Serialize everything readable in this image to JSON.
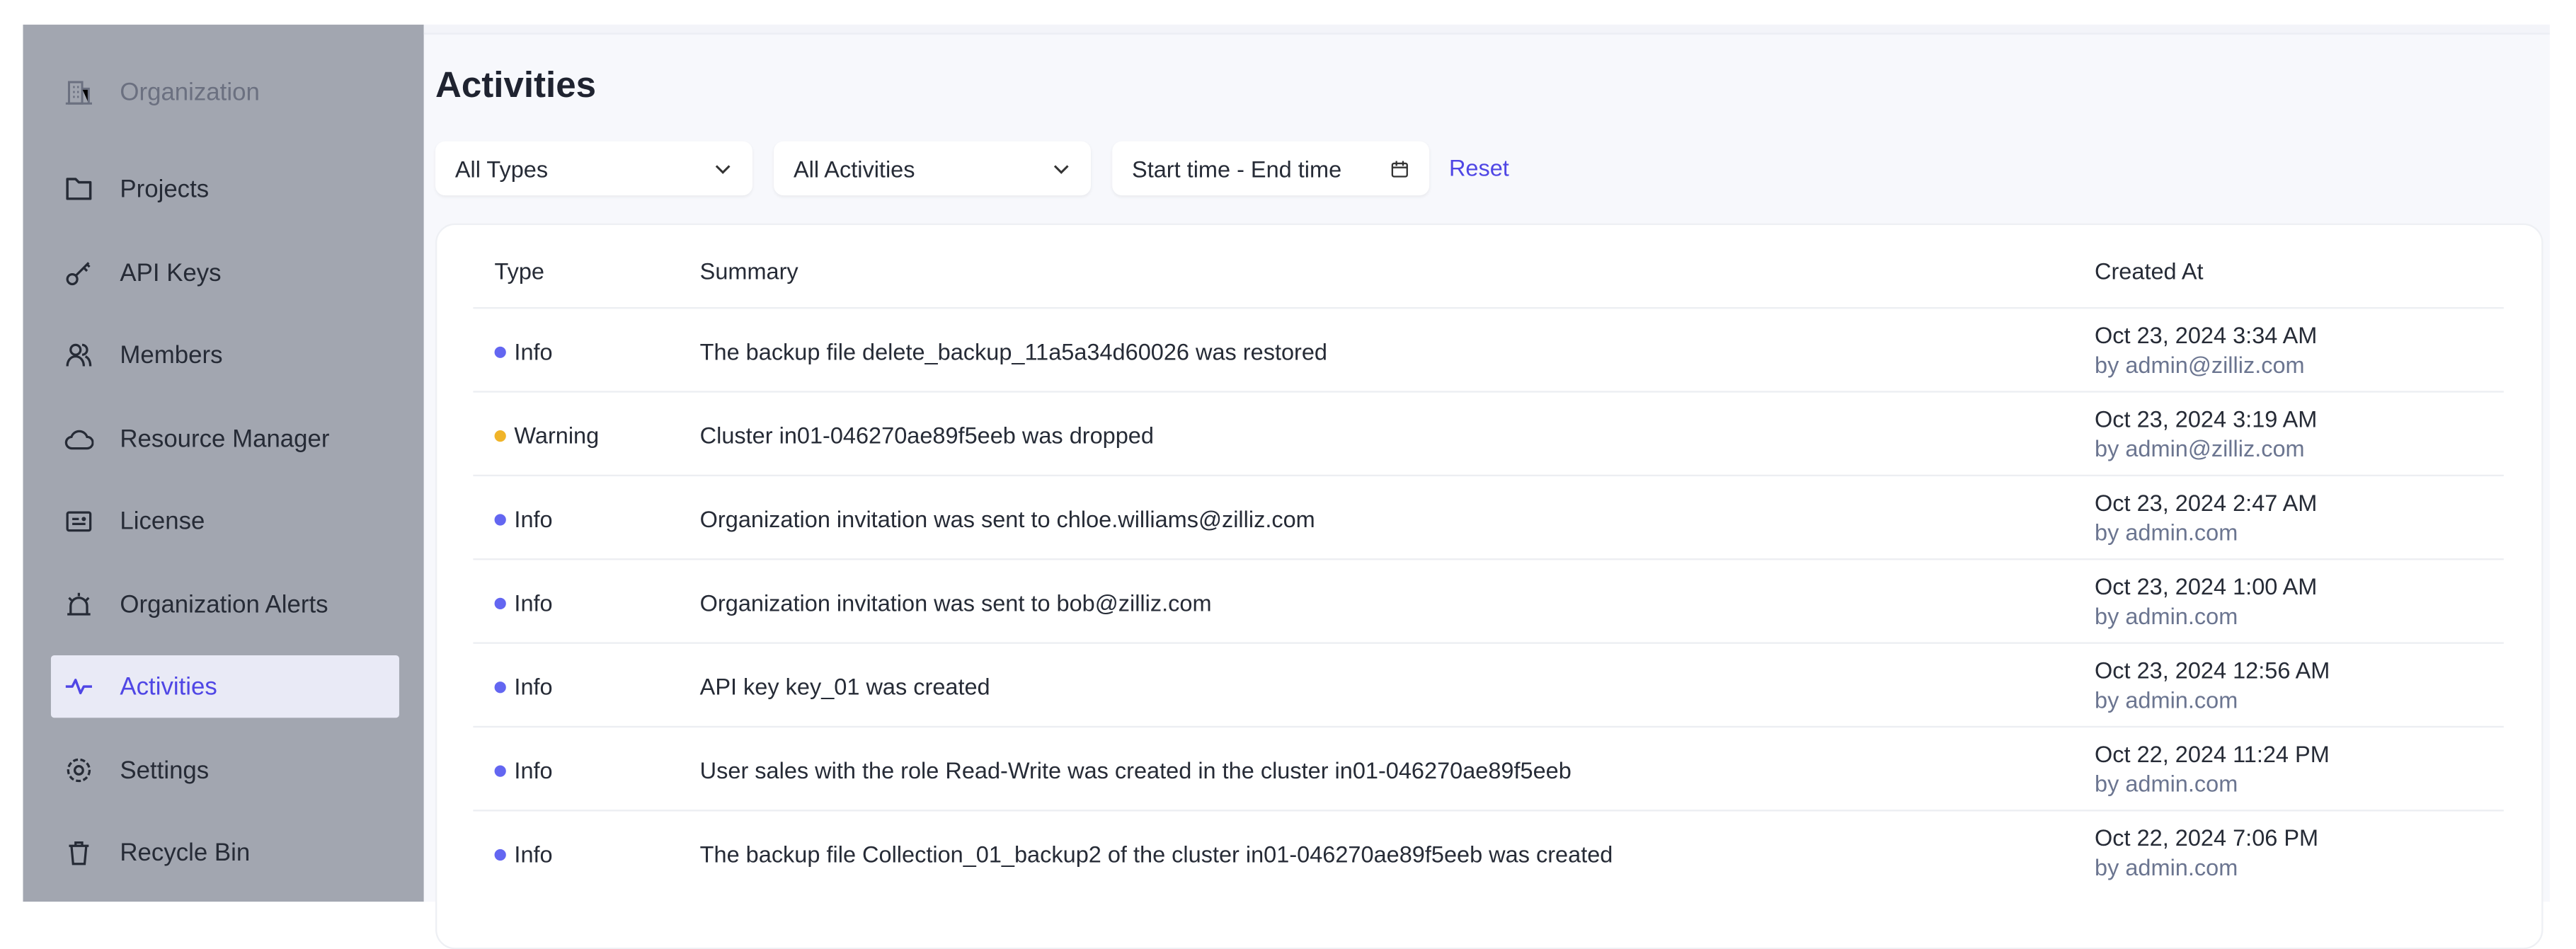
{
  "sidebar": {
    "items": [
      {
        "label": "Organization",
        "icon": "building-icon",
        "state": "disabled"
      },
      {
        "label": "Projects",
        "icon": "folder-icon"
      },
      {
        "label": "API Keys",
        "icon": "key-icon"
      },
      {
        "label": "Members",
        "icon": "users-icon"
      },
      {
        "label": "Resource Manager",
        "icon": "cloud-icon"
      },
      {
        "label": "License",
        "icon": "license-icon"
      },
      {
        "label": "Organization Alerts",
        "icon": "alarm-icon"
      },
      {
        "label": "Activities",
        "icon": "activity-icon",
        "state": "active"
      },
      {
        "label": "Settings",
        "icon": "gear-icon"
      },
      {
        "label": "Recycle Bin",
        "icon": "trash-icon"
      }
    ]
  },
  "page": {
    "title": "Activities"
  },
  "filters": {
    "type": "All Types",
    "activity": "All Activities",
    "date_placeholder": "Start time - End time",
    "reset": "Reset"
  },
  "table": {
    "headers": {
      "type": "Type",
      "summary": "Summary",
      "created": "Created At"
    },
    "rows": [
      {
        "type": "Info",
        "summary": "The backup file delete_backup_11a5a34d60026 was restored",
        "date": "Oct 23, 2024 3:34 AM",
        "by": "by admin@zilliz.com"
      },
      {
        "type": "Warning",
        "summary": "Cluster in01-046270ae89f5eeb was dropped",
        "date": "Oct 23, 2024 3:19 AM",
        "by": "by admin@zilliz.com"
      },
      {
        "type": "Info",
        "summary": "Organization invitation was sent to chloe.williams@zilliz.com",
        "date": "Oct 23, 2024 2:47 AM",
        "by": "by admin.com"
      },
      {
        "type": "Info",
        "summary": "Organization invitation was sent to bob@zilliz.com",
        "date": "Oct 23, 2024 1:00 AM",
        "by": "by admin.com"
      },
      {
        "type": "Info",
        "summary": "API key key_01 was created",
        "date": "Oct 23, 2024 12:56 AM",
        "by": "by admin.com"
      },
      {
        "type": "Info",
        "summary": "User sales with the role Read-Write was created in the cluster in01-046270ae89f5eeb",
        "date": "Oct 22, 2024 11:24 PM",
        "by": "by admin.com"
      },
      {
        "type": "Info",
        "summary": "The backup file Collection_01_backup2 of the cluster in01-046270ae89f5eeb was created",
        "date": "Oct 22, 2024 7:06 PM",
        "by": "by admin.com"
      }
    ]
  },
  "colors": {
    "accent": "#4f46e5",
    "info": "#6366f1",
    "warning": "#f0b429",
    "sidebar_bg": "#a2a6b0"
  }
}
